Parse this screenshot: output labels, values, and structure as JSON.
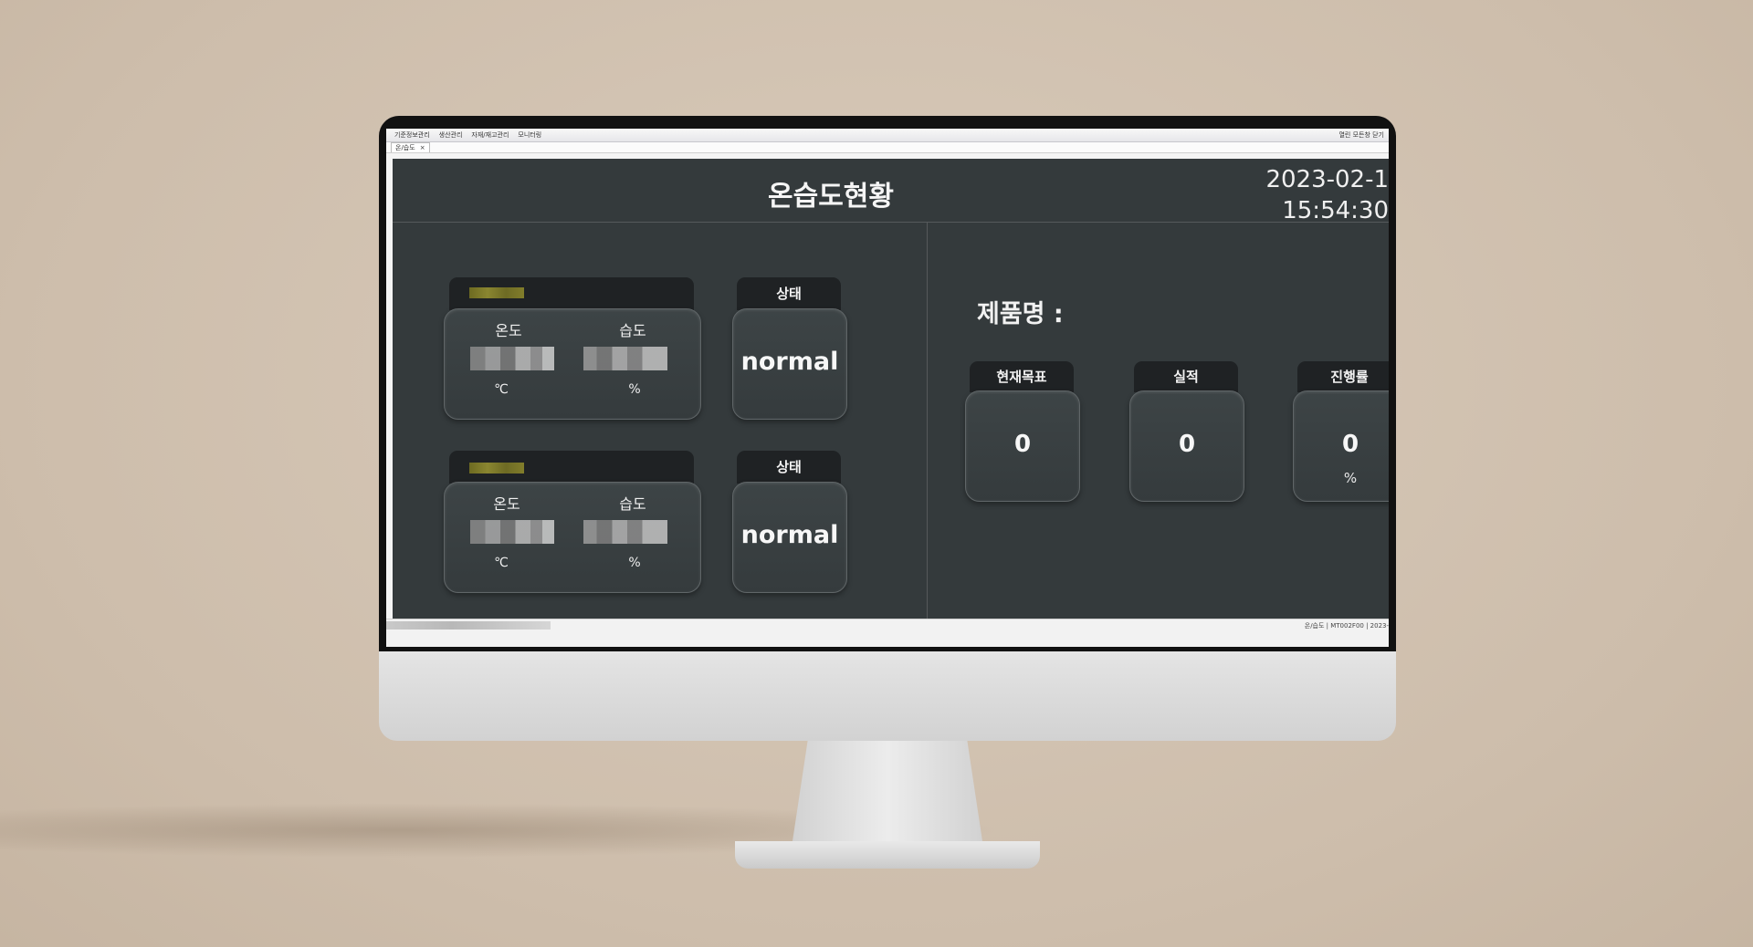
{
  "menubar": {
    "items": [
      "기준정보관리",
      "생산관리",
      "자재/재고관리",
      "모니터링"
    ],
    "right_label": "열린 모든창 닫기"
  },
  "tabbar": {
    "tabs": [
      {
        "label": "온/습도",
        "close": "×"
      }
    ]
  },
  "dashboard": {
    "title": "온습도현황",
    "date": "2023-02-1",
    "time": "15:54:30",
    "sensors": [
      {
        "temp_label": "온도",
        "humid_label": "습도",
        "temp_unit": "℃",
        "humid_unit": "%",
        "status_label": "상태",
        "status_value": "normal"
      },
      {
        "temp_label": "온도",
        "humid_label": "습도",
        "temp_unit": "℃",
        "humid_unit": "%",
        "status_label": "상태",
        "status_value": "normal"
      }
    ],
    "product_label": "제품명 :",
    "kpis": [
      {
        "label": "현재목표",
        "value": "0",
        "unit": ""
      },
      {
        "label": "실적",
        "value": "0",
        "unit": ""
      },
      {
        "label": "진행률",
        "value": "0",
        "unit": "%"
      }
    ]
  },
  "statusbar": {
    "right_text": "온/습도  |  MT002F00  |  2023-"
  },
  "colors": {
    "background": "#d3c4b3",
    "dashboard_bg": "#343a3c",
    "card_header": "#1f2224",
    "sensor_indicator": "#7f7b2a"
  }
}
